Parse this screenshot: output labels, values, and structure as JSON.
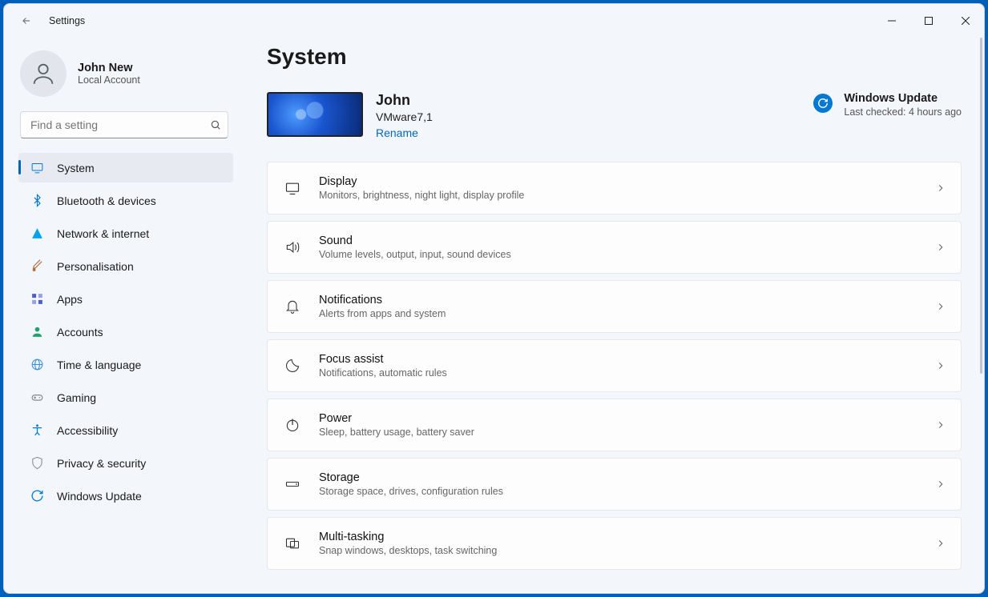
{
  "titlebar": {
    "app_name": "Settings"
  },
  "profile": {
    "name": "John New",
    "subtitle": "Local Account"
  },
  "search": {
    "placeholder": "Find a setting"
  },
  "sidebar": {
    "items": [
      {
        "id": "system",
        "label": "System",
        "icon": "display-icon",
        "color": "#0078d4",
        "selected": true
      },
      {
        "id": "bluetooth",
        "label": "Bluetooth & devices",
        "icon": "bluetooth-icon",
        "color": "#0078d4",
        "selected": false
      },
      {
        "id": "network",
        "label": "Network & internet",
        "icon": "wifi-icon",
        "color": "#00a3ee",
        "selected": false
      },
      {
        "id": "personalisation",
        "label": "Personalisation",
        "icon": "brush-icon",
        "color": "#b46b3c",
        "selected": false
      },
      {
        "id": "apps",
        "label": "Apps",
        "icon": "apps-icon",
        "color": "#4a5bd6",
        "selected": false
      },
      {
        "id": "accounts",
        "label": "Accounts",
        "icon": "person-icon",
        "color": "#1fa36a",
        "selected": false
      },
      {
        "id": "time",
        "label": "Time & language",
        "icon": "globe-icon",
        "color": "#3a8dde",
        "selected": false
      },
      {
        "id": "gaming",
        "label": "Gaming",
        "icon": "gamepad-icon",
        "color": "#7a7d82",
        "selected": false
      },
      {
        "id": "accessibility",
        "label": "Accessibility",
        "icon": "accessibility-icon",
        "color": "#0078d4",
        "selected": false
      },
      {
        "id": "privacy",
        "label": "Privacy & security",
        "icon": "shield-icon",
        "color": "#8a8d92",
        "selected": false
      },
      {
        "id": "update",
        "label": "Windows Update",
        "icon": "sync-icon",
        "color": "#0078d4",
        "selected": false
      }
    ]
  },
  "page": {
    "title": "System",
    "device": {
      "name": "John",
      "model": "VMware7,1",
      "rename_label": "Rename"
    },
    "update": {
      "title": "Windows Update",
      "subtitle": "Last checked: 4 hours ago"
    },
    "cards": [
      {
        "id": "display",
        "icon": "display-icon",
        "title": "Display",
        "subtitle": "Monitors, brightness, night light, display profile"
      },
      {
        "id": "sound",
        "icon": "sound-icon",
        "title": "Sound",
        "subtitle": "Volume levels, output, input, sound devices"
      },
      {
        "id": "notifications",
        "icon": "bell-icon",
        "title": "Notifications",
        "subtitle": "Alerts from apps and system"
      },
      {
        "id": "focus",
        "icon": "moon-icon",
        "title": "Focus assist",
        "subtitle": "Notifications, automatic rules"
      },
      {
        "id": "power",
        "icon": "power-icon",
        "title": "Power",
        "subtitle": "Sleep, battery usage, battery saver"
      },
      {
        "id": "storage",
        "icon": "storage-icon",
        "title": "Storage",
        "subtitle": "Storage space, drives, configuration rules"
      },
      {
        "id": "multitask",
        "icon": "multitask-icon",
        "title": "Multi-tasking",
        "subtitle": "Snap windows, desktops, task switching"
      }
    ]
  }
}
